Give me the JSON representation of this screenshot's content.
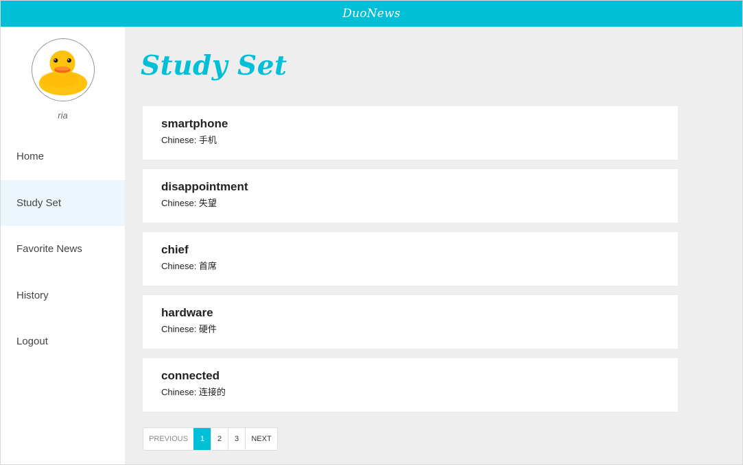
{
  "app": {
    "brand": "DuoNews"
  },
  "sidebar": {
    "username": "ria",
    "items": [
      {
        "label": "Home",
        "active": false
      },
      {
        "label": "Study Set",
        "active": true
      },
      {
        "label": "Favorite News",
        "active": false
      },
      {
        "label": "History",
        "active": false
      },
      {
        "label": "Logout",
        "active": false
      }
    ]
  },
  "main": {
    "title": "Study Set",
    "cards": [
      {
        "word": "smartphone",
        "translation": "Chinese: 手机"
      },
      {
        "word": "disappointment",
        "translation": "Chinese: 失望"
      },
      {
        "word": "chief",
        "translation": "Chinese: 首席"
      },
      {
        "word": "hardware",
        "translation": "Chinese: 硬件"
      },
      {
        "word": "connected",
        "translation": "Chinese: 连接的"
      }
    ]
  },
  "pagination": {
    "previous": "PREVIOUS",
    "pages": [
      "1",
      "2",
      "3"
    ],
    "current": "1",
    "next": "NEXT"
  },
  "colors": {
    "accent": "#00bfd6",
    "background": "#eeeeee",
    "active_nav": "#eef6fd"
  },
  "icons": {
    "avatar": "rubber-duck-icon"
  }
}
